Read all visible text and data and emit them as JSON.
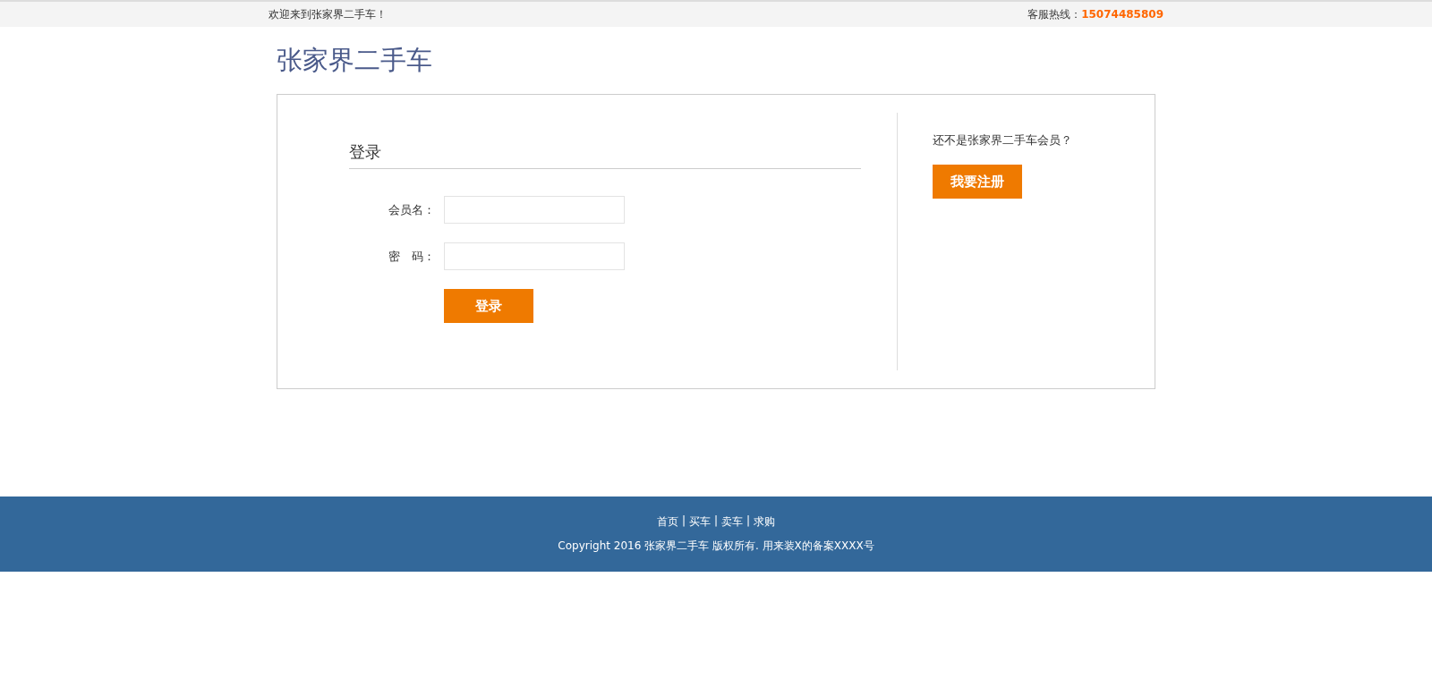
{
  "top_bar": {
    "welcome": "欢迎来到张家界二手车！",
    "hotline_label": "客服热线：",
    "hotline_number": "15074485809"
  },
  "logo": "张家界二手车",
  "login": {
    "title": "登录",
    "fields": [
      {
        "label": "会员名："
      },
      {
        "label": "密　码："
      }
    ],
    "submit": "登录"
  },
  "register": {
    "prompt": "还不是张家界二手车会员？",
    "button": "我要注册"
  },
  "footer": {
    "links": [
      "首页",
      "买车",
      "卖车",
      "求购"
    ],
    "separators": [
      "|",
      "|",
      "|"
    ],
    "copyright": "Copyright 2016 张家界二手车 版权所有. 用来装X的备案XXXX号"
  }
}
